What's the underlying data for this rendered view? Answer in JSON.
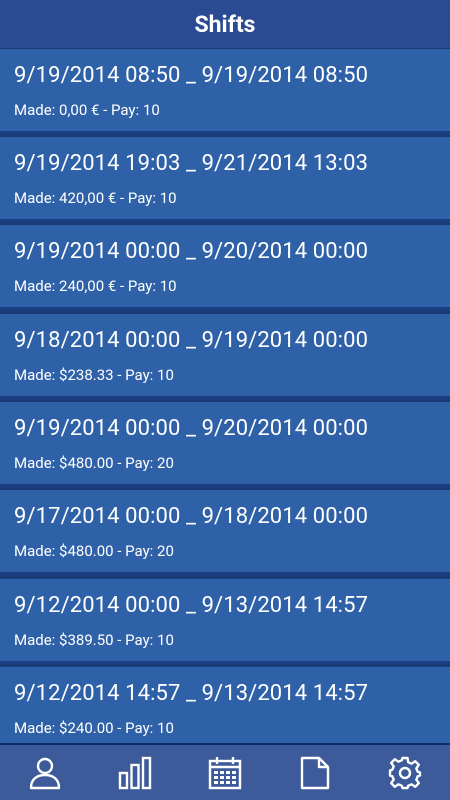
{
  "header": {
    "title": "Shifts"
  },
  "shifts": [
    {
      "range": "9/19/2014 08:50 _ 9/19/2014 08:50",
      "summary": "Made: 0,00 € - Pay: 10"
    },
    {
      "range": "9/19/2014 19:03 _ 9/21/2014 13:03",
      "summary": "Made: 420,00 € - Pay: 10"
    },
    {
      "range": "9/19/2014 00:00 _ 9/20/2014 00:00",
      "summary": "Made: 240,00 € - Pay: 10"
    },
    {
      "range": "9/18/2014 00:00 _ 9/19/2014 00:00",
      "summary": "Made: $238.33 - Pay: 10"
    },
    {
      "range": "9/19/2014 00:00 _ 9/20/2014 00:00",
      "summary": "Made: $480.00 - Pay: 20"
    },
    {
      "range": "9/17/2014 00:00 _ 9/18/2014 00:00",
      "summary": "Made: $480.00 - Pay: 20"
    },
    {
      "range": "9/12/2014 00:00 _ 9/13/2014 14:57",
      "summary": "Made: $389.50 - Pay: 10"
    },
    {
      "range": "9/12/2014 14:57 _ 9/13/2014 14:57",
      "summary": "Made: $240.00 - Pay: 10"
    }
  ],
  "navbar": {
    "items": [
      {
        "icon": "user-icon"
      },
      {
        "icon": "bar-chart-icon"
      },
      {
        "icon": "calendar-icon"
      },
      {
        "icon": "document-icon"
      },
      {
        "icon": "gear-icon"
      }
    ]
  },
  "colors": {
    "header_bg": "#2a4a93",
    "row_bg": "#2f61a8",
    "row_divider": "#1a3f83",
    "navbar_bg": "#3d5a9a",
    "text": "#ffffff"
  }
}
